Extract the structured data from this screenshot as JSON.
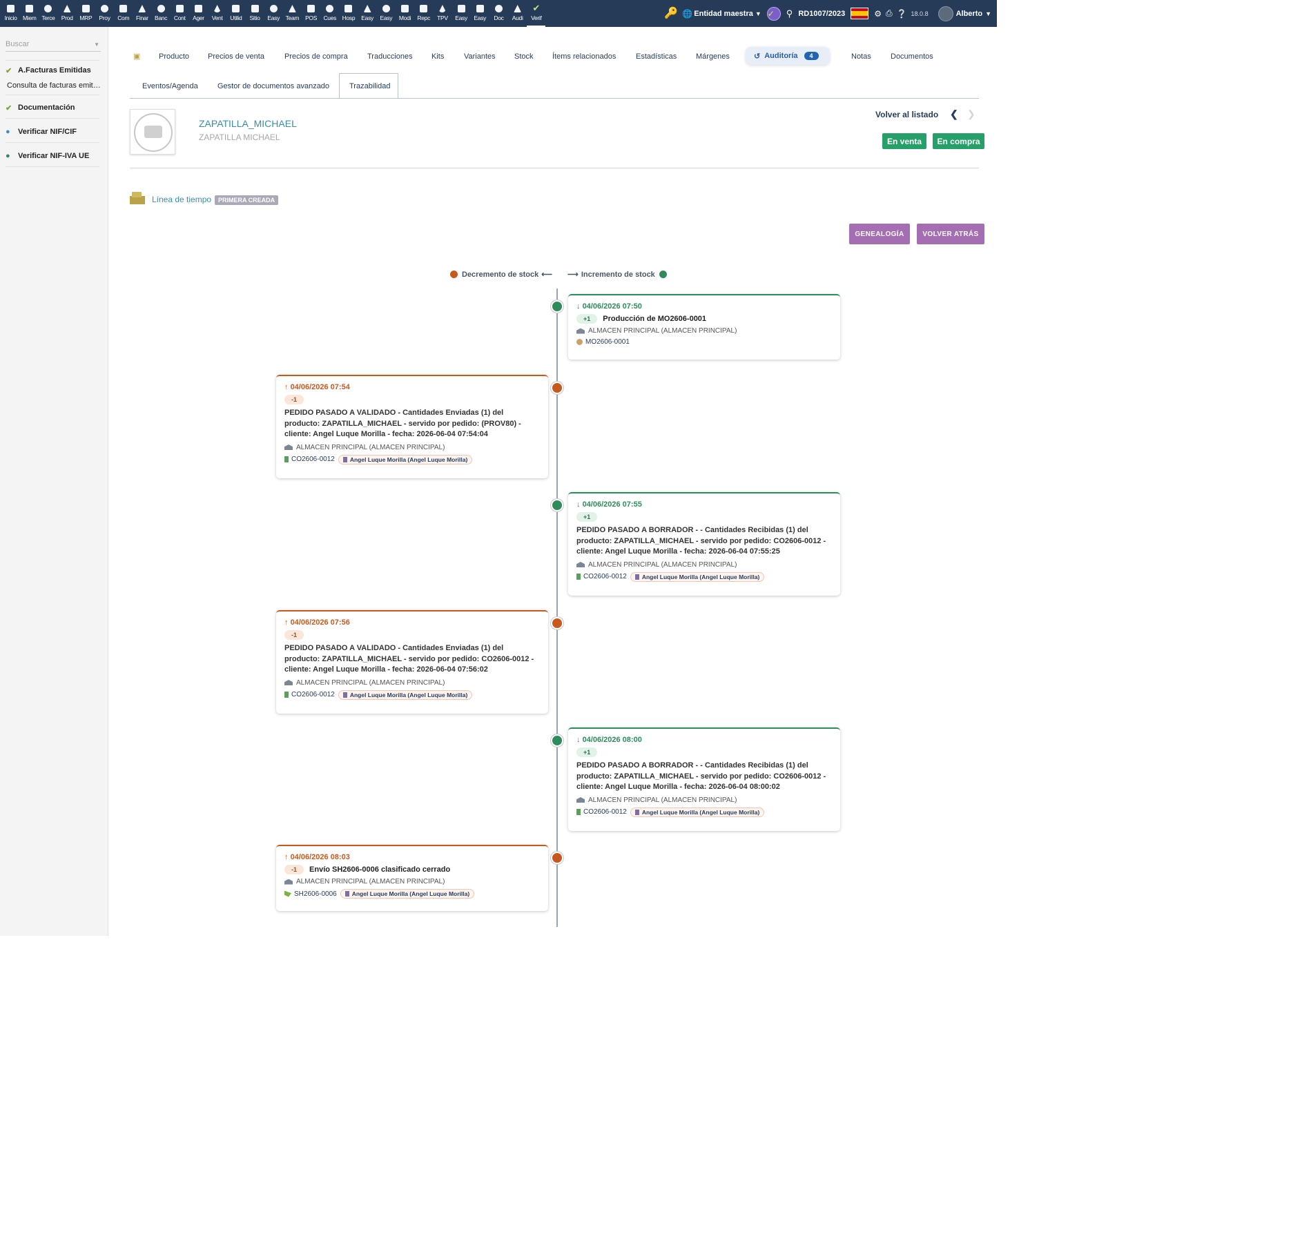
{
  "topbar": {
    "modules": [
      "Inicio",
      "Miem",
      "Terce",
      "Prod",
      "MRP",
      "Proy",
      "Com",
      "Finar",
      "Banc",
      "Cont",
      "Ager",
      "Vent",
      "Utilid",
      "Sitio",
      "Easy",
      "Team",
      "POS",
      "Cues",
      "Hosp",
      "Easy",
      "Easy",
      "Modi",
      "Repc",
      "TPV",
      "Easy",
      "Easy",
      "Doc",
      "Audi",
      "Verif"
    ],
    "entity": "Entidad maestra",
    "ref": "RD1007/2023",
    "version": "18.0.8",
    "user": "Alberto"
  },
  "left_menu": {
    "search_placeholder": "Buscar",
    "entries": [
      {
        "label": "A.Facturas Emitidas"
      },
      {
        "label": "Consulta de facturas emitidas"
      },
      {
        "label": "Documentación"
      },
      {
        "label": "Verificar NIF/CIF"
      },
      {
        "label": "Verificar NIF-IVA UE"
      }
    ]
  },
  "tabs": {
    "row1": [
      "Producto",
      "Precios de venta",
      "Precios de compra",
      "Traducciones",
      "Kits",
      "Variantes",
      "Stock",
      "Ítems relacionados",
      "Estadísticas",
      "Márgenes",
      "Auditoría",
      "Notas",
      "Documentos"
    ],
    "audit_count": "4",
    "row2": [
      "Eventos/Agenda",
      "Gestor de documentos avanzado",
      "Trazabilidad"
    ]
  },
  "product": {
    "ref": "ZAPATILLA_MICHAEL",
    "label": "ZAPATILLA MICHAEL",
    "back_to_list": "Volver al listado",
    "on_sale": "En venta",
    "on_purchase": "En compra"
  },
  "timeline": {
    "title": "Línea de tiempo",
    "badge": "PRIMERA CREADA",
    "btn_genealogy": "GENEALOGÍA",
    "btn_back": "VOLVER ATRÁS",
    "legend_dec": "Decremento de stock",
    "legend_inc": "Incremento de stock",
    "events": [
      {
        "type": "inc",
        "date": "04/06/2026 07:50",
        "qty": "+1",
        "title": "Producción de MO2606-0001",
        "desc": "",
        "warehouse": "ALMACEN PRINCIPAL (ALMACEN PRINCIPAL)",
        "doc": "MO2606-0001",
        "customer": ""
      },
      {
        "type": "dec",
        "date": "04/06/2026 07:54",
        "qty": "-1",
        "title": "",
        "desc": "PEDIDO PASADO A VALIDADO - Cantidades Enviadas (1) del producto: ZAPATILLA_MICHAEL - servido por pedido: (PROV80) - cliente: Angel Luque Morilla - fecha: 2026-06-04 07:54:04",
        "warehouse": "ALMACEN PRINCIPAL (ALMACEN PRINCIPAL)",
        "doc": "CO2606-0012",
        "customer": "Angel Luque Morilla (Angel Luque Morilla)"
      },
      {
        "type": "inc",
        "date": "04/06/2026 07:55",
        "qty": "+1",
        "title": "",
        "desc": "PEDIDO PASADO A BORRADOR - - Cantidades Recibidas (1) del producto: ZAPATILLA_MICHAEL - servido por pedido: CO2606-0012 - cliente: Angel Luque Morilla - fecha: 2026-06-04 07:55:25",
        "warehouse": "ALMACEN PRINCIPAL (ALMACEN PRINCIPAL)",
        "doc": "CO2606-0012",
        "customer": "Angel Luque Morilla (Angel Luque Morilla)"
      },
      {
        "type": "dec",
        "date": "04/06/2026 07:56",
        "qty": "-1",
        "title": "",
        "desc": "PEDIDO PASADO A VALIDADO - Cantidades Enviadas (1) del producto: ZAPATILLA_MICHAEL - servido por pedido: CO2606-0012 - cliente: Angel Luque Morilla - fecha: 2026-06-04 07:56:02",
        "warehouse": "ALMACEN PRINCIPAL (ALMACEN PRINCIPAL)",
        "doc": "CO2606-0012",
        "customer": "Angel Luque Morilla (Angel Luque Morilla)"
      },
      {
        "type": "inc",
        "date": "04/06/2026 08:00",
        "qty": "+1",
        "title": "",
        "desc": "PEDIDO PASADO A BORRADOR - - Cantidades Recibidas (1) del producto: ZAPATILLA_MICHAEL - servido por pedido: CO2606-0012 - cliente: Angel Luque Morilla - fecha: 2026-06-04 08:00:02",
        "warehouse": "ALMACEN PRINCIPAL (ALMACEN PRINCIPAL)",
        "doc": "CO2606-0012",
        "customer": "Angel Luque Morilla (Angel Luque Morilla)"
      },
      {
        "type": "dec",
        "date": "04/06/2026 08:03",
        "qty": "-1",
        "title": "Envío SH2606-0006 clasificado cerrado",
        "desc": "",
        "warehouse": "ALMACEN PRINCIPAL (ALMACEN PRINCIPAL)",
        "doc": "SH2606-0006",
        "customer": "Angel Luque Morilla (Angel Luque Morilla)"
      }
    ]
  }
}
